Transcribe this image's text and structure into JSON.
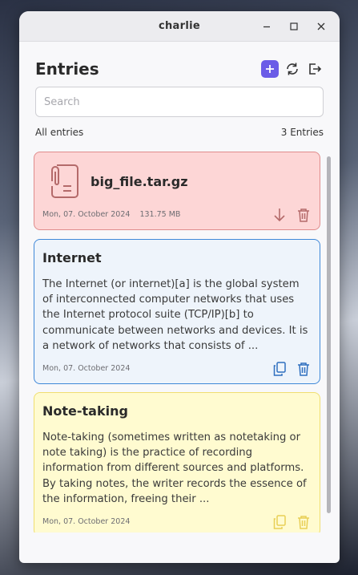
{
  "window": {
    "title": "charlie"
  },
  "header": {
    "title": "Entries"
  },
  "search": {
    "placeholder": "Search",
    "value": ""
  },
  "list_meta": {
    "filter_label": "All entries",
    "count_label": "3 Entries"
  },
  "entries": [
    {
      "type": "file",
      "name": "big_file.tar.gz",
      "date": "Mon, 07. October 2024",
      "size": "131.75 MB",
      "color": "#fdd6d6"
    },
    {
      "type": "note",
      "title": "Internet",
      "body": "The Internet (or internet)[a] is the global system of interconnected computer networks that uses the Internet protocol suite (TCP/IP)[b] to communicate between networks and devices. It is a network of networks that consists of ...",
      "date": "Mon, 07. October 2024",
      "color": "#eef4fb"
    },
    {
      "type": "note",
      "title": "Note-taking",
      "body": "Note-taking (sometimes written as notetaking or note taking) is the practice of recording information from different sources and platforms. By taking notes, the writer records the essence of the information, freeing their ...",
      "date": "Mon, 07. October 2024",
      "color": "#fffbd0"
    }
  ],
  "colors": {
    "accent": "#6b5ce7",
    "file_icon": "#b46a6a",
    "blue_icon": "#2f6fbf",
    "yellow_icon": "#e8cf55"
  }
}
